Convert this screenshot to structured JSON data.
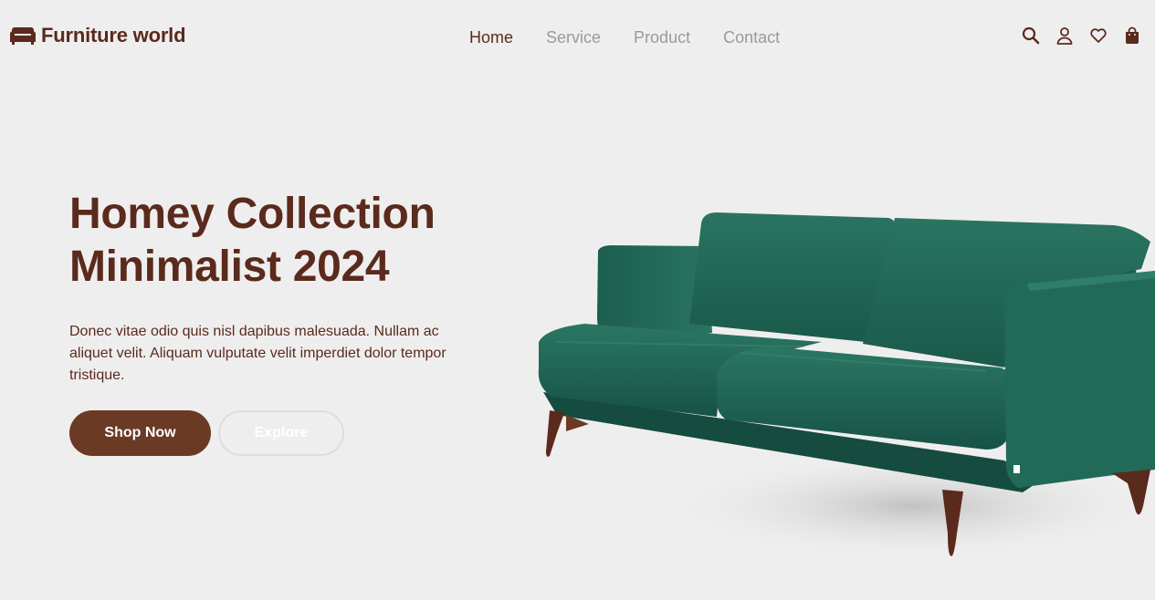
{
  "brand": {
    "name": "Furniture world",
    "icon": "sofa-icon",
    "color": "#5a2a1c"
  },
  "nav": {
    "items": [
      {
        "label": "Home",
        "active": true
      },
      {
        "label": "Service",
        "active": false
      },
      {
        "label": "Product",
        "active": false
      },
      {
        "label": "Contact",
        "active": false
      }
    ],
    "active_color": "#5a2a1c",
    "inactive_color": "#9a9a9a"
  },
  "header_icons": [
    "search-icon",
    "user-icon",
    "heart-icon",
    "shopping-bag-icon"
  ],
  "hero": {
    "title_line1": "Homey Collection",
    "title_line2": "Minimalist 2024",
    "description": "Donec vitae odio quis nisl dapibus malesuada. Nullam ac aliquet velit. Aliquam vulputate velit imperdiet dolor tempor tristique.",
    "primary_button": "Shop Now",
    "secondary_button": "Explore"
  },
  "colors": {
    "background": "#efeeee",
    "accent": "#6b3a24",
    "sofa_fabric": "#1f6555"
  }
}
